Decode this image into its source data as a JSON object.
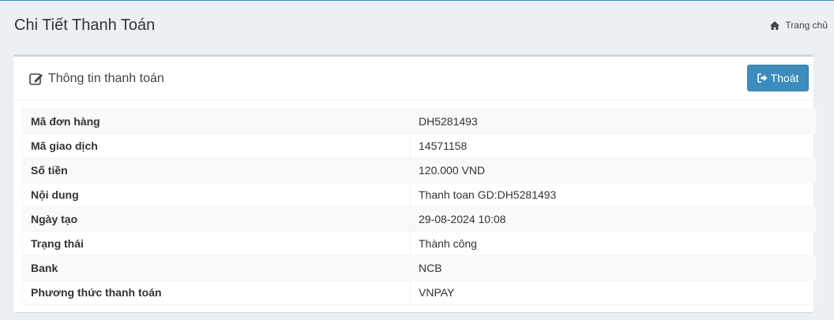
{
  "header": {
    "title": "Chi Tiết Thanh Toán",
    "breadcrumb_home": "Trang chủ",
    "breadcrumb_icon": "home-icon"
  },
  "box": {
    "title": "Thông tin thanh toán",
    "title_icon": "edit-icon",
    "exit_label": "Thoát",
    "exit_icon": "sign-out-icon",
    "accent_color": "#3c8dbc"
  },
  "details": [
    {
      "label": "Mã đơn hàng",
      "value": "DH5281493"
    },
    {
      "label": "Mã giao dịch",
      "value": "14571158"
    },
    {
      "label": "Số tiền",
      "value": "120.000 VND"
    },
    {
      "label": "Nội dung",
      "value": "Thanh toan GD:DH5281493"
    },
    {
      "label": "Ngày tạo",
      "value": "29-08-2024 10:08"
    },
    {
      "label": "Trạng thái",
      "value": "Thành công"
    },
    {
      "label": "Bank",
      "value": "NCB"
    },
    {
      "label": "Phương thức thanh toán",
      "value": "VNPAY"
    }
  ]
}
